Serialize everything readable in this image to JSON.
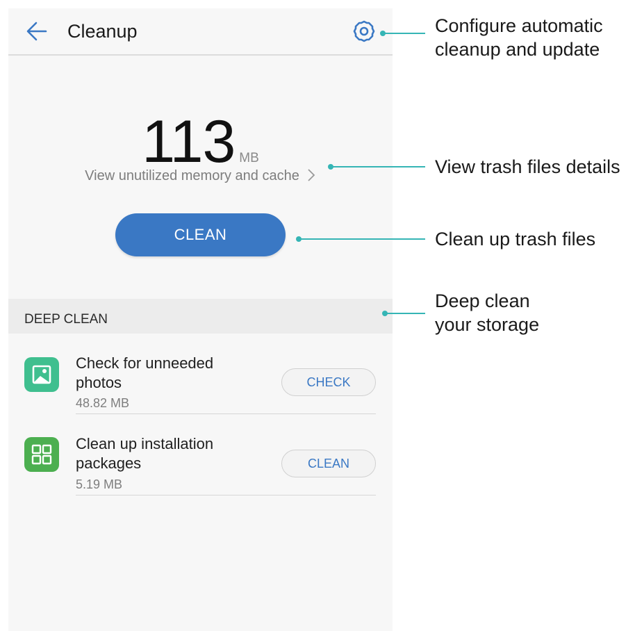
{
  "appbar": {
    "title": "Cleanup"
  },
  "summary": {
    "size_value": "113",
    "size_unit": "MB",
    "detail_link": "View unutilized memory and cache",
    "clean_button": "CLEAN"
  },
  "deep_clean": {
    "header": "DEEP CLEAN",
    "items": [
      {
        "title": "Check for unneeded photos",
        "size": "48.82 MB",
        "button": "CHECK",
        "icon": "photo-icon"
      },
      {
        "title": "Clean up installation packages",
        "size": "5.19 MB",
        "button": "CLEAN",
        "icon": "apps-grid-icon"
      }
    ]
  },
  "callouts": {
    "settings": {
      "line1": "Configure automatic",
      "line2": "cleanup and update"
    },
    "details": "View trash files details",
    "clean": "Clean up trash files",
    "deep": {
      "line1": "Deep clean",
      "line2": "your storage"
    }
  },
  "colors": {
    "accent": "#3a78c4",
    "callout_line": "#35b5b5",
    "photo_icon": "#3fbf8f",
    "apps_icon": "#4caf50"
  }
}
